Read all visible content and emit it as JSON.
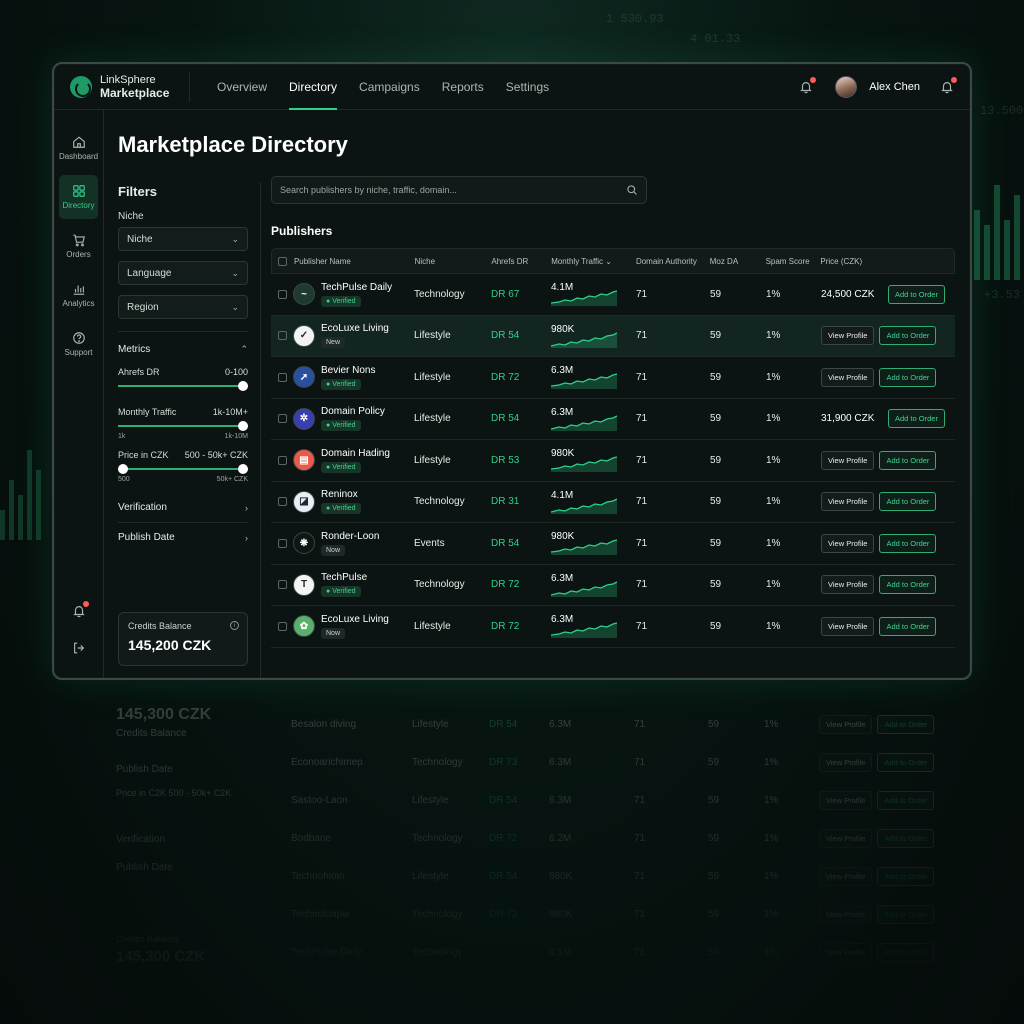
{
  "background": {
    "ticker_1": "1 530.93",
    "ticker_2": "4 01.33",
    "ticker_3": "13.500",
    "ticker_4": "+3.53"
  },
  "brand": {
    "line1": "LinkSphere",
    "line2": "Marketplace"
  },
  "nav": {
    "items": [
      {
        "label": "Overview",
        "active": false
      },
      {
        "label": "Directory",
        "active": true
      },
      {
        "label": "Campaigns",
        "active": false
      },
      {
        "label": "Reports",
        "active": false
      },
      {
        "label": "Settings",
        "active": false
      }
    ]
  },
  "user": {
    "name": "Alex Chen"
  },
  "rail": {
    "items": [
      {
        "label": "Dashboard",
        "icon": "home-icon"
      },
      {
        "label": "Directory",
        "icon": "grid-icon",
        "active": true
      },
      {
        "label": "Orders",
        "icon": "cart-icon"
      },
      {
        "label": "Analytics",
        "icon": "chart-icon"
      },
      {
        "label": "Support",
        "icon": "help-icon"
      }
    ]
  },
  "page": {
    "title": "Marketplace Directory"
  },
  "filters": {
    "title": "Filters",
    "niche_label": "Niche",
    "niche_select": "Niche",
    "language_select": "Language",
    "region_select": "Region",
    "metrics_label": "Metrics",
    "ahrefs": {
      "label": "Ahrefs DR",
      "range": "0-100"
    },
    "traffic": {
      "label": "Monthly Traffic",
      "range": "1k-10M+",
      "min": "1k",
      "max": "1k-10M"
    },
    "price": {
      "label": "Price in CZK",
      "range": "500 - 50k+ CZK",
      "min": "500",
      "max": "50k+ CZK"
    },
    "verification_label": "Verification",
    "publish_date_label": "Publish Date"
  },
  "credits": {
    "label": "Credits Balance",
    "value": "145,200 CZK"
  },
  "search": {
    "placeholder": "Search publishers by niche, traffic, domain..."
  },
  "publishers": {
    "title": "Publishers",
    "columns": [
      "Publisher Name",
      "Niche",
      "Ahrefs DR",
      "Monthly Traffic",
      "Domain Authority",
      "Moz DA",
      "Spam Score",
      "Price (CZK)"
    ],
    "view_label": "View Profile",
    "add_label": "Add to Order",
    "rows": [
      {
        "name": "TechPulse Daily",
        "badge": "Verified",
        "niche": "Technology",
        "dr": "DR 67",
        "traffic": "4.1M",
        "da": "71",
        "moz": "59",
        "spam": "1%",
        "price": "24,500 CZK",
        "logo_color": "#1f3a30",
        "logo_glyph": "~",
        "highlight": false
      },
      {
        "name": "EcoLuxe Living",
        "badge": "New",
        "niche": "Lifestyle",
        "dr": "DR 54",
        "traffic": "980K",
        "da": "71",
        "moz": "59",
        "spam": "1%",
        "price": "",
        "logo_color": "#f2f2f2",
        "logo_glyph": "✓",
        "highlight": true
      },
      {
        "name": "Bevier Nons",
        "badge": "Verified",
        "niche": "Lifestyle",
        "dr": "DR 72",
        "traffic": "6.3M",
        "da": "71",
        "moz": "59",
        "spam": "1%",
        "price": "",
        "logo_color": "#2a4f9e",
        "logo_glyph": "➚",
        "highlight": false
      },
      {
        "name": "Domain Policy",
        "badge": "Verified",
        "niche": "Lifestyle",
        "dr": "DR 54",
        "traffic": "6.3M",
        "da": "71",
        "moz": "59",
        "spam": "1%",
        "price": "31,900 CZK",
        "logo_color": "#3a3fb0",
        "logo_glyph": "✲",
        "highlight": false
      },
      {
        "name": "Domain Hading",
        "badge": "Verified",
        "niche": "Lifestyle",
        "dr": "DR 53",
        "traffic": "980K",
        "da": "71",
        "moz": "59",
        "spam": "1%",
        "price": "",
        "logo_color": "#e85b4a",
        "logo_glyph": "▤",
        "highlight": false
      },
      {
        "name": "Reninox",
        "badge": "Verified",
        "niche": "Technology",
        "dr": "DR 31",
        "traffic": "4.1M",
        "da": "71",
        "moz": "59",
        "spam": "1%",
        "price": "",
        "logo_color": "#e9eef5",
        "logo_glyph": "◪",
        "highlight": false
      },
      {
        "name": "Ronder-Loon",
        "badge": "Now",
        "niche": "Events",
        "dr": "DR 54",
        "traffic": "980K",
        "da": "71",
        "moz": "59",
        "spam": "1%",
        "price": "",
        "logo_color": "#101614",
        "logo_glyph": "❋",
        "highlight": false
      },
      {
        "name": "TechPulse",
        "badge": "Verified",
        "niche": "Technology",
        "dr": "DR 72",
        "traffic": "6.3M",
        "da": "71",
        "moz": "59",
        "spam": "1%",
        "price": "",
        "logo_color": "#f4f4f4",
        "logo_glyph": "T",
        "highlight": false
      },
      {
        "name": "EcoLuxe Living",
        "badge": "Now",
        "niche": "Lifestyle",
        "dr": "DR 72",
        "traffic": "6.3M",
        "da": "71",
        "moz": "59",
        "spam": "1%",
        "price": "",
        "logo_color": "#5ab06a",
        "logo_glyph": "✿",
        "highlight": false
      }
    ]
  },
  "reflection": {
    "credits_value": "145,300 CZK",
    "credits_label": "Credits Balance",
    "publish_date": "Publish Date",
    "price_label": "Price in C2K   500 - 50k+ C2K",
    "verification": "Verification",
    "rows": [
      {
        "name": "Besalon diving",
        "niche": "Lifestyle",
        "dr": "DR 54",
        "traffic": "6.3M"
      },
      {
        "name": "Econoarichimep",
        "niche": "Technology",
        "dr": "DR 73",
        "traffic": "6.3M"
      },
      {
        "name": "Sastoo-Laon",
        "niche": "Lifestyle",
        "dr": "DR 54",
        "traffic": "6.3M"
      },
      {
        "name": "Bodbane",
        "niche": "Technology",
        "dr": "DR 72",
        "traffic": "6.2M"
      },
      {
        "name": "Technohioin",
        "niche": "Lifestyle",
        "dr": "DR 54",
        "traffic": "980K"
      },
      {
        "name": "Technoloapw",
        "niche": "Technology",
        "dr": "DR 72",
        "traffic": "980K"
      },
      {
        "name": "TechPulse Daily",
        "niche": "Technology",
        "dr": "",
        "traffic": "4.1M"
      }
    ]
  },
  "colors": {
    "accent": "#2fd08a",
    "bg": "#0b1412",
    "alert": "#ff5a5a"
  }
}
